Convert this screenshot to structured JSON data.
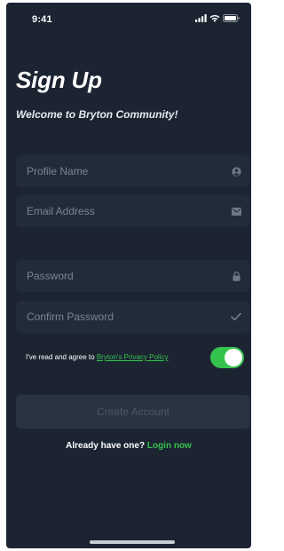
{
  "status_bar": {
    "time": "9:41",
    "icons": [
      "cellular-signal-icon",
      "wifi-icon",
      "battery-icon"
    ]
  },
  "header": {
    "title": "Sign Up",
    "subtitle": "Welcome to Bryton Community!"
  },
  "form": {
    "profile_name": {
      "placeholder": "Profile Name",
      "value": "",
      "icon": "person-icon"
    },
    "email": {
      "placeholder": "Email Address",
      "value": "",
      "icon": "mail-icon"
    },
    "password": {
      "placeholder": "Password",
      "value": "",
      "icon": "lock-icon"
    },
    "confirm_password": {
      "placeholder": "Confirm Password",
      "value": "",
      "icon": "checkmark-icon"
    }
  },
  "agreement": {
    "text": "I've read and agree to ",
    "link": "Bryton's Privacy Policy",
    "toggle_on": true
  },
  "actions": {
    "create_account": "Create Account",
    "already_have": "Already have one?",
    "login_link": "Login now"
  },
  "colors": {
    "background": "#1c2432",
    "field_background": "#222b39",
    "accent_green": "#35c24d",
    "placeholder": "#7b8494",
    "disabled_button": "#2a3341"
  }
}
